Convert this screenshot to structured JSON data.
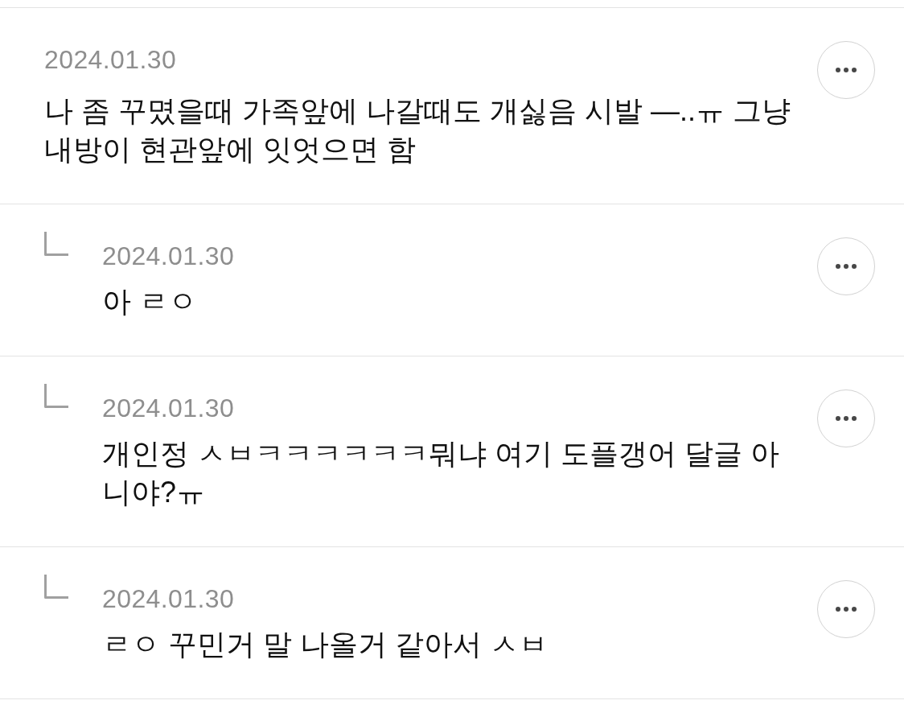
{
  "comments": [
    {
      "kind": "comment",
      "date": "2024.01.30",
      "text": "나 좀 꾸몄을때 가족앞에 나갈때도 개싫음 시발 —..ㅠ 그냥 내방이 현관앞에 잇엇으면 함"
    },
    {
      "kind": "reply",
      "date": "2024.01.30",
      "text": "아 ㄹㅇ"
    },
    {
      "kind": "reply",
      "date": "2024.01.30",
      "text": "개인정 ㅅㅂㅋㅋㅋㅋㅋㅋ뭐냐 여기 도플갱어 달글 아니야?ㅠ"
    },
    {
      "kind": "reply",
      "date": "2024.01.30",
      "text": "ㄹㅇ 꾸민거 말 나올거 같아서 ㅅㅂ"
    }
  ]
}
